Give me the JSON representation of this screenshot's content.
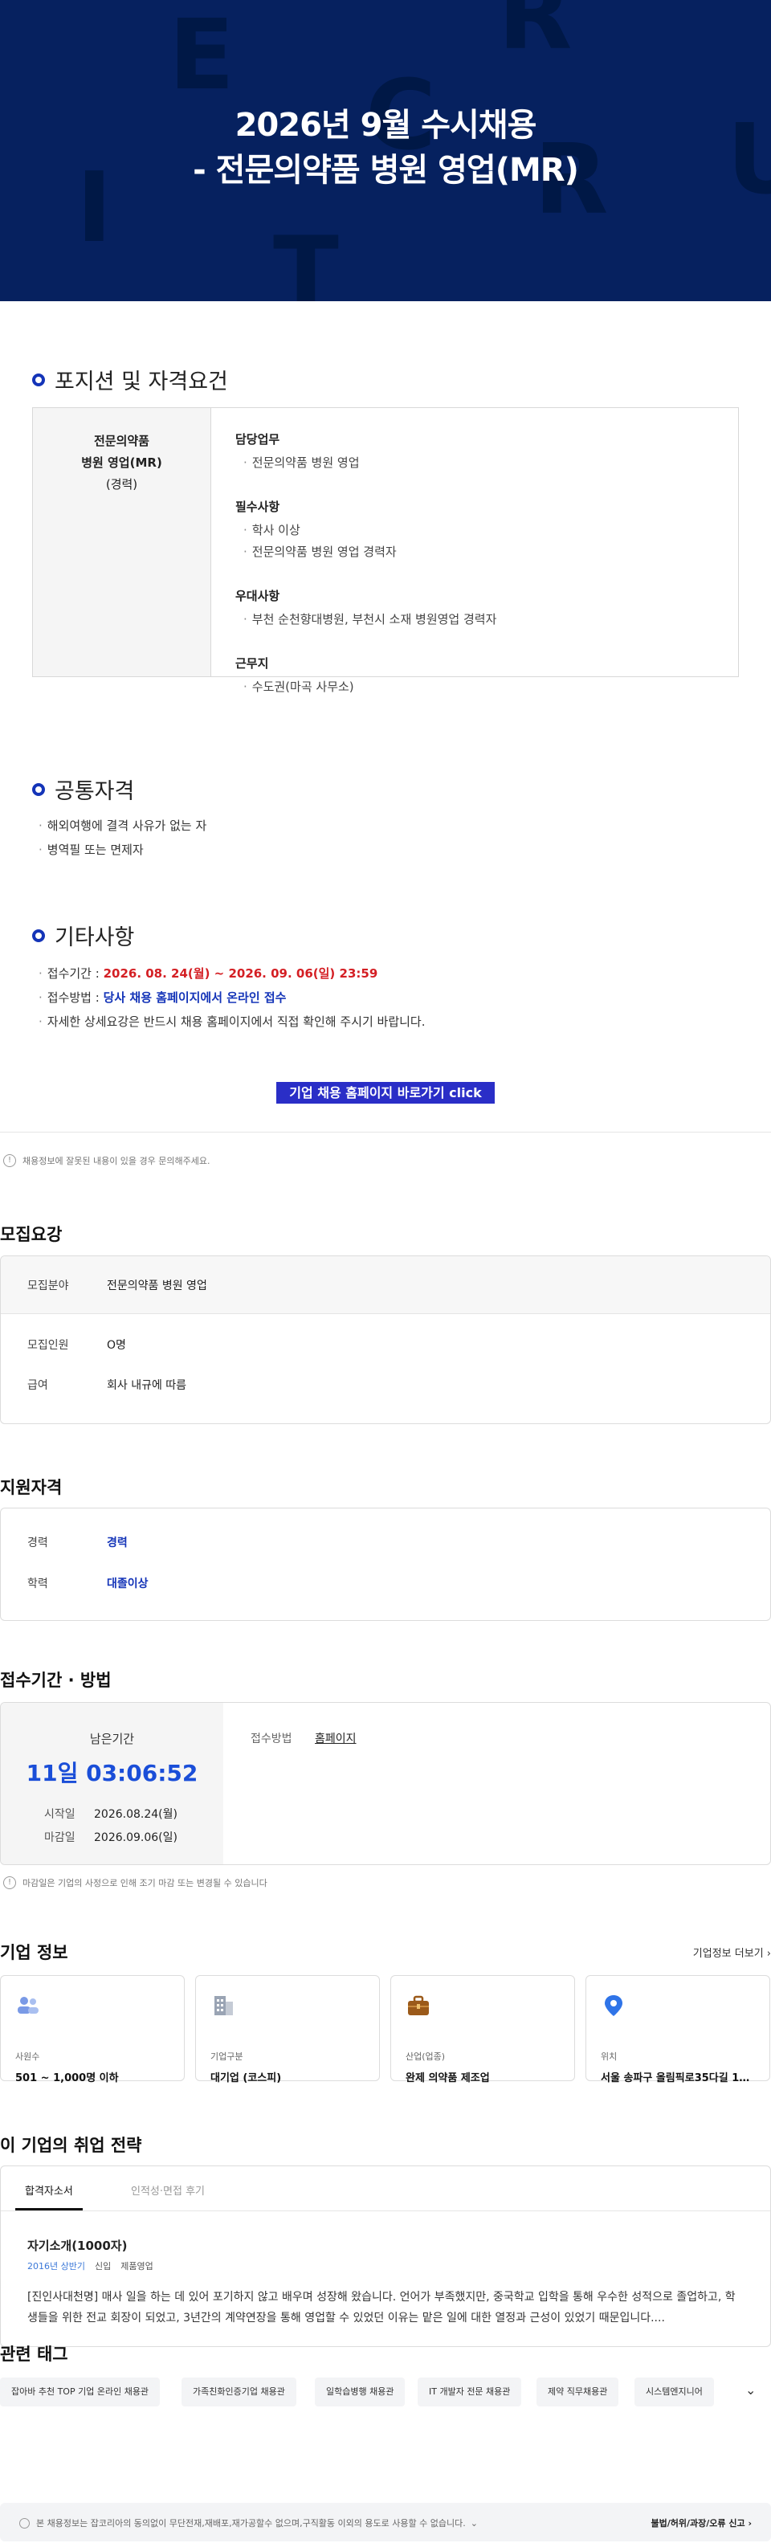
{
  "hero": {
    "title_line1": "2026년 9월 수시채용",
    "title_line2": "- 전문의약품 병원 영업(MR)",
    "deco_letters": [
      "E",
      "R",
      "C",
      "U",
      "I",
      "T",
      "R"
    ]
  },
  "position": {
    "heading": "포지션 및 자격요건",
    "left": {
      "line1": "전문의약품",
      "line2": "병원 영업(MR)",
      "line3": "(경력)"
    },
    "groups": [
      {
        "title": "담당업무",
        "items": [
          "전문의약품 병원 영업"
        ]
      },
      {
        "title": "필수사항",
        "items": [
          "학사 이상",
          "전문의약품 병원 영업 경력자"
        ]
      },
      {
        "title": "우대사항",
        "items": [
          "부천 순천향대병원, 부천시 소재 병원영업 경력자"
        ]
      },
      {
        "title": "근무지",
        "items": [
          "수도권(마곡 사무소)"
        ]
      }
    ]
  },
  "common": {
    "heading": "공통자격",
    "items": [
      "해외여행에 결격 사유가 없는 자",
      "병역필 또는 면제자"
    ]
  },
  "etc": {
    "heading": "기타사항",
    "period_label": "접수기간 : ",
    "period_value": "2026. 08. 24(월) ~ 2026. 09. 06(일) 23:59",
    "method_label": "접수방법 : ",
    "method_value": "당사 채용 홈페이지에서 온라인 접수",
    "detail": "자세한 상세요강은 반드시 채용 홈페이지에서 직접 확인해 주시기 바랍니다."
  },
  "cta_label": "기업 채용 홈페이지 바로가기 click",
  "notice_error": "채용정보에 잘못된 내용이 있을 경우 문의해주세요.",
  "recruit": {
    "title": "모집요강",
    "field_label": "모집분야",
    "field_value": "전문의약품 병원 영업",
    "count_label": "모집인원",
    "count_value": "O명",
    "salary_label": "급여",
    "salary_value": "회사 내규에 따름"
  },
  "qualification": {
    "title": "지원자격",
    "career_label": "경력",
    "career_value": "경력",
    "edu_label": "학력",
    "edu_value": "대졸이상"
  },
  "apply": {
    "title": "접수기간 · 방법",
    "remain_label": "남은기간",
    "remain_value": "11일 03:06:52",
    "start_label": "시작일",
    "start_value": "2026.08.24(월)",
    "end_label": "마감일",
    "end_value": "2026.09.06(일)",
    "method_label": "접수방법",
    "method_value": "홈페이지",
    "notice": "마감일은 기업의 사정으로 인해 조기 마감 또는 변경될 수 있습니다"
  },
  "company": {
    "title": "기업 정보",
    "more_label": "기업정보 더보기",
    "cards": [
      {
        "label": "사원수",
        "value": "501 ~ 1,000명 이하",
        "icon": "people-icon"
      },
      {
        "label": "기업구분",
        "value": "대기업 (코스피)",
        "icon": "building-icon"
      },
      {
        "label": "산업(업종)",
        "value": "완제 의약품 제조업",
        "icon": "briefcase-icon"
      },
      {
        "label": "위치",
        "value": "서울 송파구 올림픽로35다길 13 ...",
        "icon": "location-pin-icon"
      }
    ],
    "colors": {
      "people": "#7a9ae6",
      "building": "#9aa4b4",
      "briefcase": "#9b5a1a",
      "pin": "#2f74e8"
    }
  },
  "strategy": {
    "title": "이 기업의 취업 전략",
    "tab_active": "합격자소서",
    "tab_other": "인적성·면접 후기",
    "item_title": "자기소개(1000자)",
    "year": "2016년 상반기",
    "type": "신입",
    "dept": "제품영업",
    "body": "[진인사대천명] 매사 일을 하는 데 있어 포기하지 않고 배우며 성장해 왔습니다. 언어가 부족했지만, 중국학교 입학을 통해 우수한 성적으로 졸업하고, 학생들을 위한 전교 회장이 되었고, 3년간의 계약연장을 통해 영업할 수 있었던 이유는 맡은 일에 대한 열정과 근성이 있었기 때문입니다...."
  },
  "tags": {
    "title": "관련 태그",
    "items": [
      "잡아바 추천 TOP 기업 온라인 채용관",
      "가족친화인증기업 채용관",
      "일학습병행 채용관",
      "IT 개발자 전문 채용관",
      "제약 직무채용관",
      "시스템엔지니어"
    ]
  },
  "footer": {
    "info": "본 채용정보는 잡코리아의 동의없이 무단전재,재배포,재가공할수 없으며,구직활동 이외의 용도로 사용할 수 없습니다.",
    "report": "불법/허위/과장/오류 신고"
  },
  "colors": {
    "hero_bg": "#06215f",
    "accent_blue": "#1434b8",
    "cta_bg": "#2a2ec7",
    "red": "#d41f24",
    "remain_blue": "#1a4ed8"
  }
}
